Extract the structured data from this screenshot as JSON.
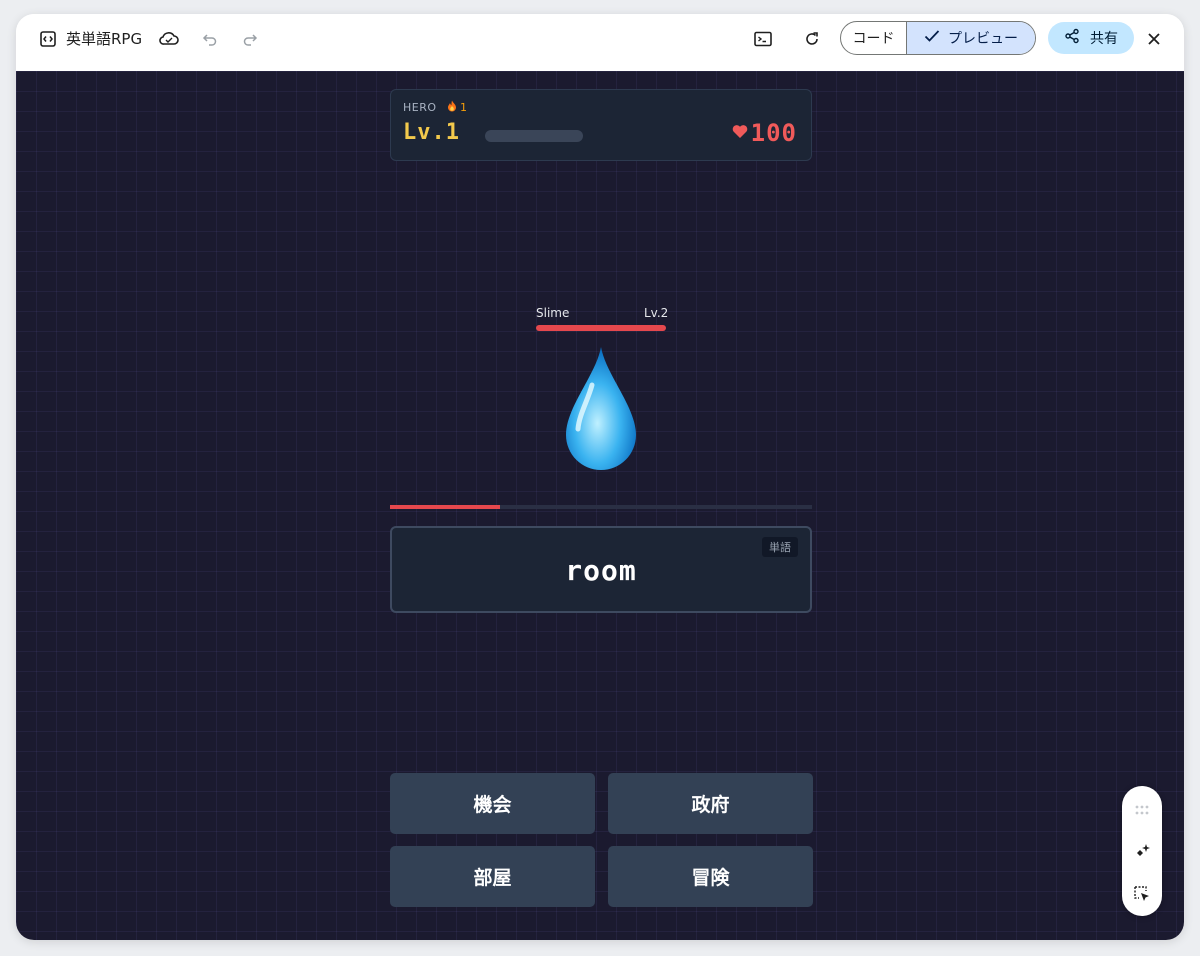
{
  "topbar": {
    "app_title": "英単語RPG",
    "code_label": "コード",
    "preview_label": "プレビュー",
    "share_label": "共有"
  },
  "hud": {
    "hero_label": "HERO",
    "streak": "1",
    "level": "Lv.1",
    "hp": "100",
    "xp_fraction": 0
  },
  "enemy": {
    "name": "Slime",
    "level": "Lv.2",
    "hp_fraction": 1.0
  },
  "timer_fraction": 0.26,
  "question": {
    "badge": "単語",
    "word": "room"
  },
  "answers": [
    "機会",
    "政府",
    "部屋",
    "冒険"
  ],
  "colors": {
    "canvas_bg": "#1b1a2f",
    "level_gold": "#f2c94c",
    "hp_red": "#f05a5a",
    "answer_bg": "#334155",
    "preview_selected": "#d3e3fd",
    "share_bg": "#c2e7ff"
  },
  "icons": {
    "code_icon": "code-icon",
    "cloud": "cloud-icon",
    "undo": "undo-icon",
    "redo": "redo-icon",
    "terminal": "terminal-icon",
    "refresh": "refresh-icon",
    "check": "check-icon",
    "share": "share-icon",
    "close": "close-icon",
    "streak": "fire-icon",
    "heart": "heart-icon",
    "enemy": "water-drop-icon",
    "drag": "drag-handle-icon",
    "sparkle": "sparkle-icon",
    "select": "select-element-icon"
  }
}
